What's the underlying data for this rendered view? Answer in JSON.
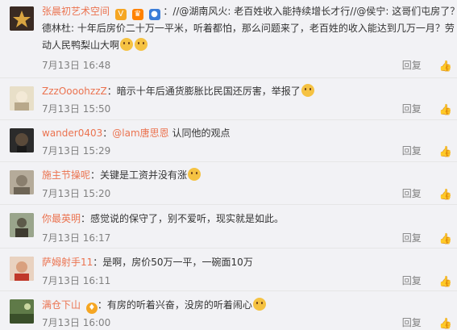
{
  "comments": [
    {
      "user": "张晨初艺术空间",
      "lines": [
        "：//@湖南风火: 老百姓收入能持续增长才行//@侯宁: 这哥们屯房了？//@",
        "德林杜: 十年后房价二十万一平米，听着都怕，那么问题来了，老百姓的收入能达到几万一月？劳",
        "动人民鸭梨山大啊"
      ],
      "date": "7月13日 16:48",
      "reply": "回复",
      "avatar_color": "#3a2a22"
    },
    {
      "user": "ZzzOooohzzZ",
      "text": "：暗示十年后通货膨胀比民国还厉害，举报了",
      "date": "7月13日 15:50",
      "reply": "回复",
      "avatar_color": "#d6c9a8"
    },
    {
      "user": "wander0403",
      "mention": "@lam唐思恩",
      "text": "认同他的观点",
      "date": "7月13日 15:29",
      "reply": "回复",
      "avatar_color": "#2b2b2b"
    },
    {
      "user": "施主节操呢",
      "text": "：关键是工资并没有涨",
      "date": "7月13日 15:20",
      "reply": "回复",
      "avatar_color": "#a59c8c"
    },
    {
      "user": "你最英明",
      "text": "：感觉说的保守了，别不爱听，现实就是如此。",
      "date": "7月13日 16:17",
      "reply": "回复",
      "avatar_color": "#6d7a5c"
    },
    {
      "user": "萨姆射手11",
      "text": "：是啊，房价50万一平，一碗面10万",
      "date": "7月13日 16:11",
      "reply": "回复",
      "avatar_color": "#c48b6c"
    },
    {
      "user": "满仓下山",
      "text": "：有房的听着兴奋，没房的听着闹心",
      "date": "7月13日 16:00",
      "reply": "回复",
      "avatar_color": "#4e6b3a"
    }
  ]
}
